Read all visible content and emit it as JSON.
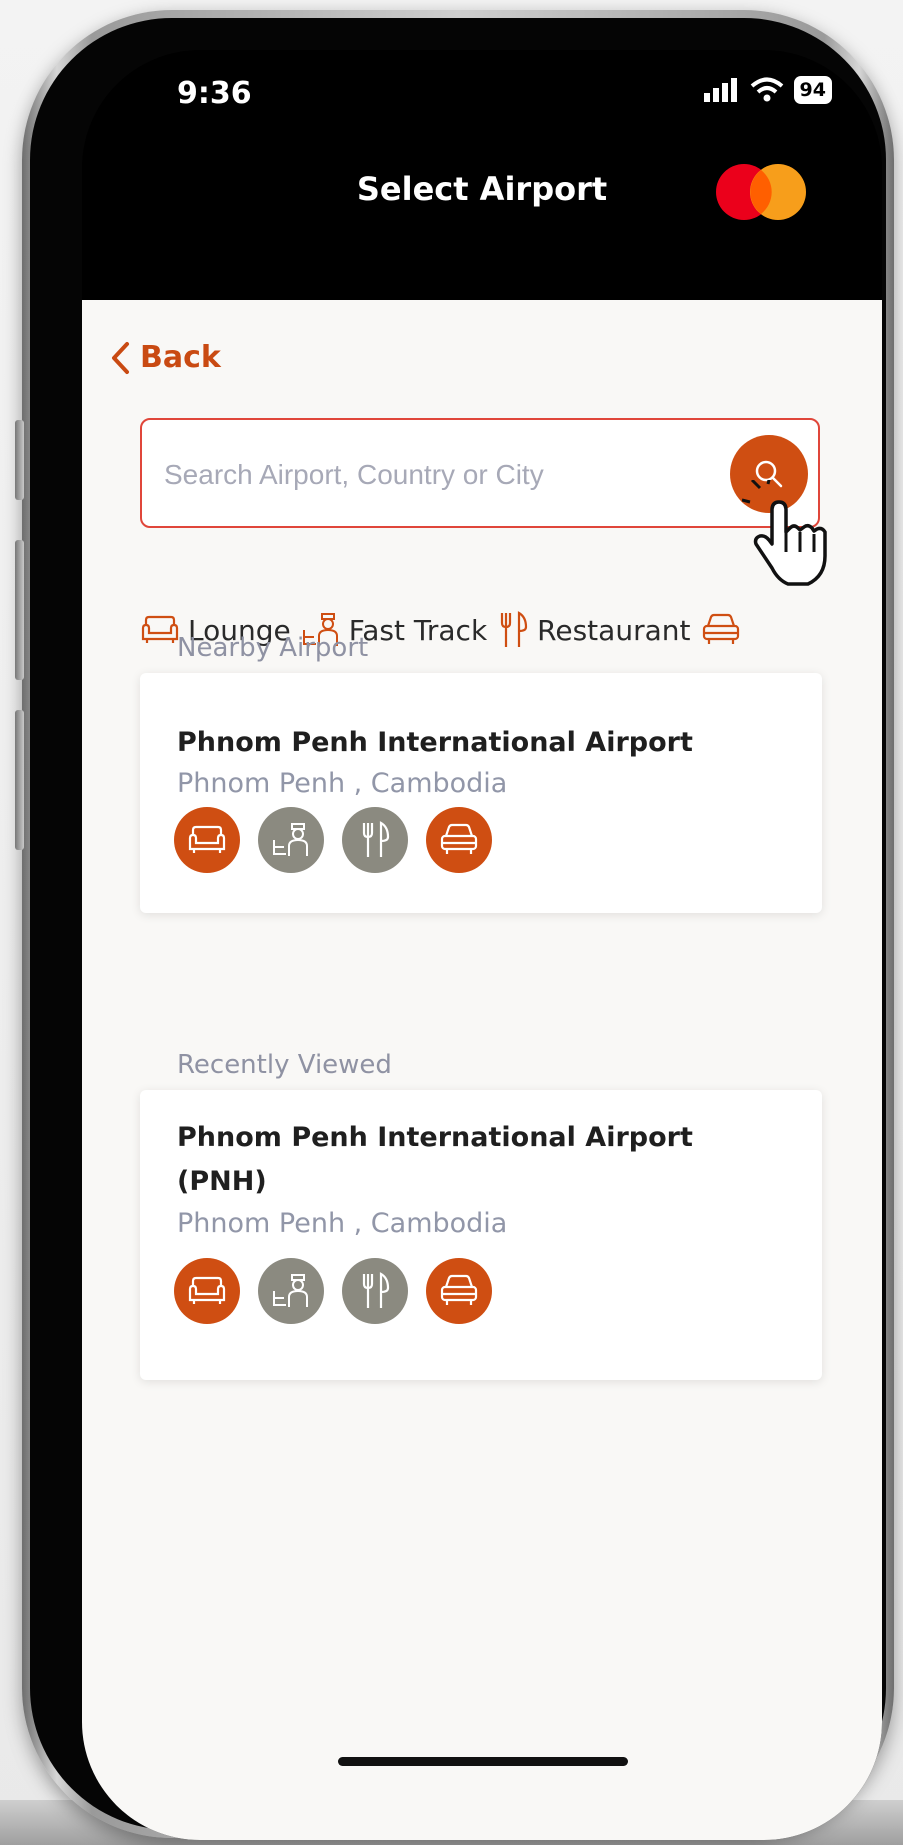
{
  "status_bar": {
    "time": "9:36",
    "battery": "94"
  },
  "header": {
    "title": "Select Airport"
  },
  "back": {
    "label": "Back"
  },
  "search": {
    "placeholder": "Search Airport, Country or City"
  },
  "filters": [
    {
      "label": "Lounge",
      "icon": "sofa-icon"
    },
    {
      "label": "Fast Track",
      "icon": "fast-track-icon"
    },
    {
      "label": "Restaurant",
      "icon": "fork-knife-icon"
    },
    {
      "label": "",
      "icon": "car-icon"
    }
  ],
  "nearby": {
    "label": "Nearby Airport",
    "airport": {
      "name": "Phnom Penh International Airport",
      "location": "Phnom Penh , Cambodia"
    }
  },
  "recent": {
    "label": "Recently Viewed",
    "airport": {
      "name": "Phnom Penh International Airport (PNH)",
      "location": "Phnom Penh , Cambodia"
    }
  },
  "colors": {
    "accent": "#cf4e12",
    "inactive": "#8b8a80",
    "search_border": "#e0463a",
    "mc_red": "#eb001b",
    "mc_orange": "#f79e1b"
  },
  "service_badges": [
    {
      "icon": "sofa-icon",
      "active": true
    },
    {
      "icon": "fast-track-icon",
      "active": false
    },
    {
      "icon": "fork-knife-icon",
      "active": false
    },
    {
      "icon": "car-icon",
      "active": true
    }
  ]
}
